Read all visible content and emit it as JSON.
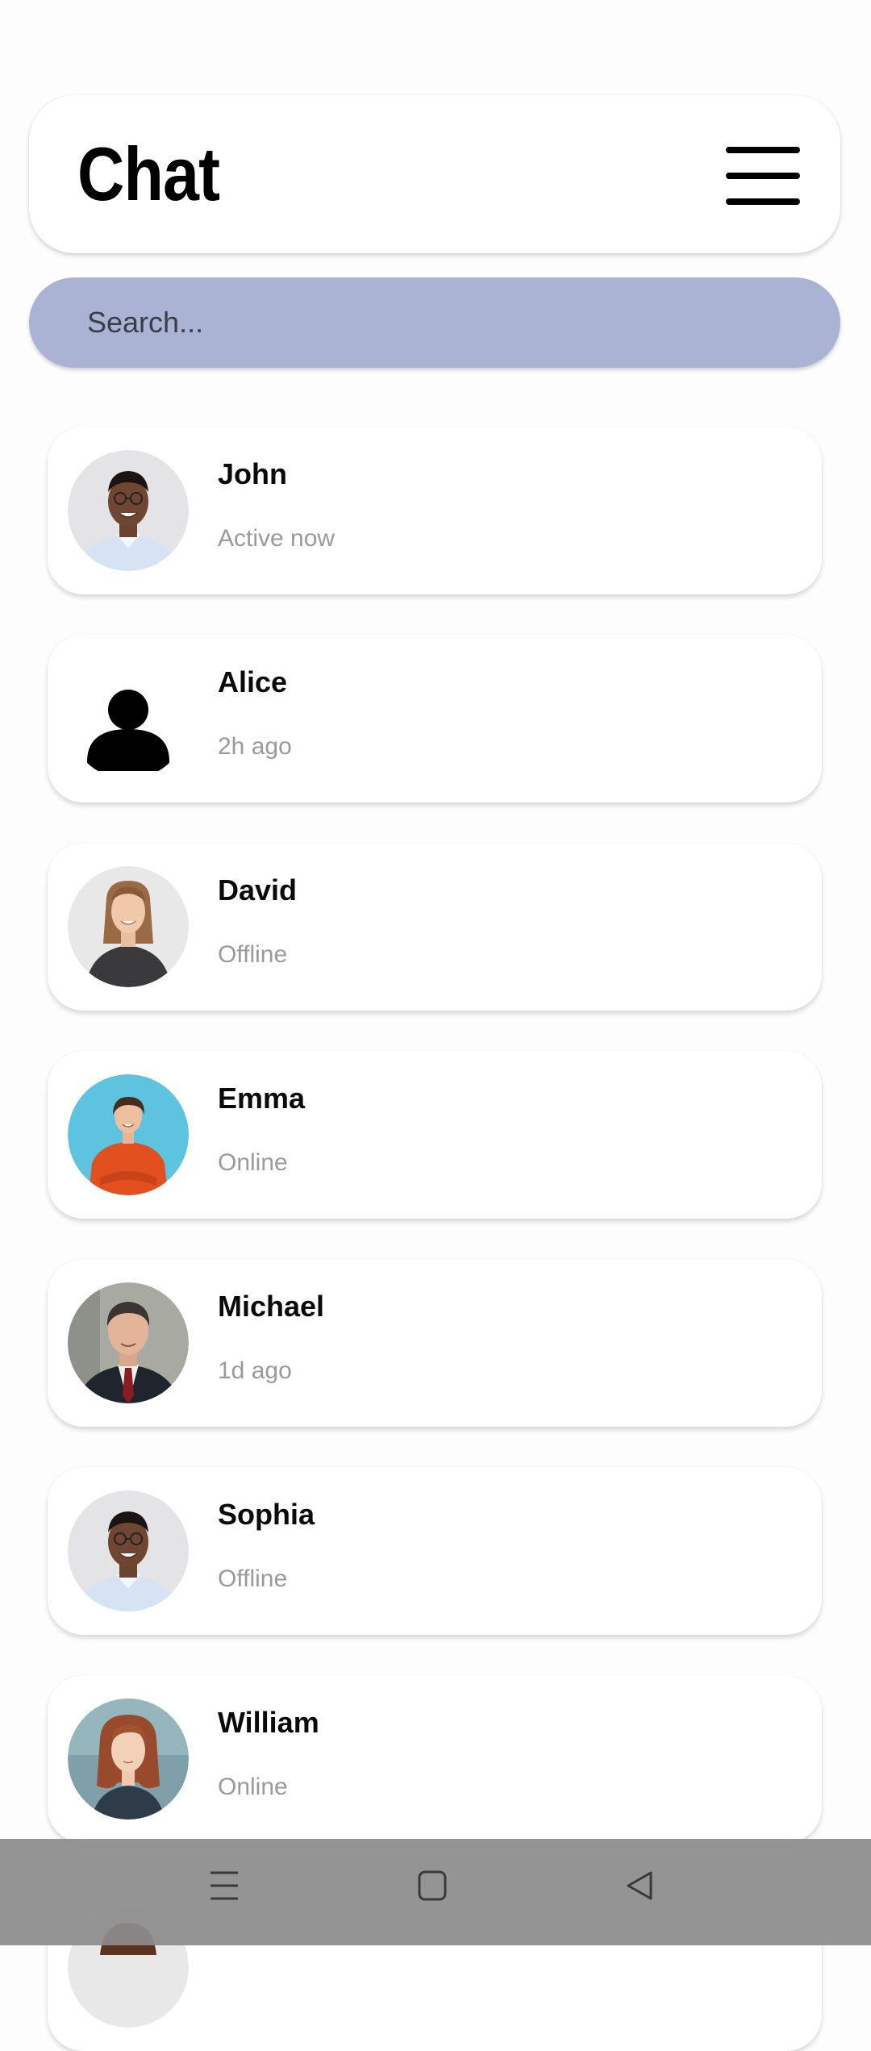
{
  "header": {
    "title": "Chat",
    "menu_icon": "hamburger-menu-icon"
  },
  "search": {
    "placeholder": "Search..."
  },
  "chats": [
    {
      "name": "John",
      "status": "Active now",
      "avatar": "photo-man-glasses"
    },
    {
      "name": "Alice",
      "status": "2h ago",
      "avatar": "person-silhouette-icon"
    },
    {
      "name": "David",
      "status": "Offline",
      "avatar": "photo-woman-smiling"
    },
    {
      "name": "Emma",
      "status": "Online",
      "avatar": "photo-woman-orange-shirt"
    },
    {
      "name": "Michael",
      "status": "1d ago",
      "avatar": "photo-man-suit"
    },
    {
      "name": "Sophia",
      "status": "Offline",
      "avatar": "photo-man-glasses"
    },
    {
      "name": "William",
      "status": "Online",
      "avatar": "photo-woman-red-hair"
    }
  ],
  "navigation_bar": {
    "buttons": [
      "recents-icon",
      "home-icon",
      "back-icon"
    ]
  },
  "colors": {
    "search_bg": "#aab3d4",
    "status_text": "#9a9a9a",
    "card_bg": "#ffffff"
  }
}
